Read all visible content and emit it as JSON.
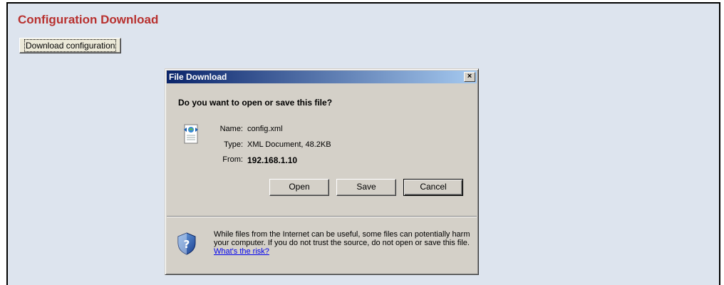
{
  "page": {
    "title": "Configuration Download",
    "download_button": "Download configuration"
  },
  "dialog": {
    "title": "File Download",
    "close_glyph": "×",
    "question": "Do you want to open or save this file?",
    "file": {
      "name_label": "Name:",
      "name_value": "config.xml",
      "type_label": "Type:",
      "type_value": "XML Document, 48.2KB",
      "from_label": "From:",
      "from_value": "192.168.1.10"
    },
    "buttons": {
      "open": "Open",
      "save": "Save",
      "cancel": "Cancel"
    },
    "warning": {
      "text": "While files from the Internet can be useful, some files can potentially harm your computer. If you do not trust the source, do not open or save this file.",
      "link": "What's the risk?"
    }
  },
  "icons": {
    "file": "xml-file-icon",
    "shield": "security-shield-icon",
    "close": "close-icon"
  },
  "colors": {
    "page_bg": "#dde4ee",
    "title_red": "#b8312f",
    "dialog_bg": "#d4d0c8",
    "titlebar_start": "#0a246a",
    "titlebar_end": "#a6caf0"
  }
}
